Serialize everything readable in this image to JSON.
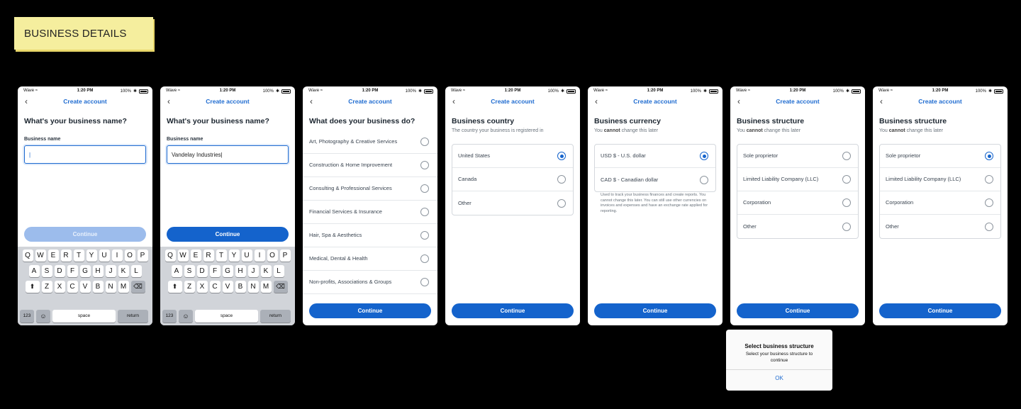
{
  "label": "BUSINESS DETAILS",
  "status_bar": {
    "carrier": "Wave",
    "time": "1:20 PM",
    "battery": "100%"
  },
  "nav_title": "Create account",
  "screens": {
    "name_empty": {
      "heading": "What's your business name?",
      "field_label": "Business name",
      "value": "|",
      "button": "Continue"
    },
    "name_filled": {
      "heading": "What's your business name?",
      "field_label": "Business name",
      "value": "Vandelay Industries|",
      "button": "Continue"
    },
    "industry": {
      "heading": "What does your business do?",
      "options": [
        "Art, Photography & Creative Services",
        "Construction & Home Improvement",
        "Consulting & Professional Services",
        "Financial Services & Insurance",
        "Hair, Spa & Aesthetics",
        "Medical, Dental & Health",
        "Non-profits, Associations & Groups"
      ],
      "button": "Continue"
    },
    "country": {
      "heading": "Business country",
      "sub": "The country your business is registered in",
      "options": [
        "United States",
        "Canada",
        "Other"
      ],
      "selected": "United States",
      "button": "Continue"
    },
    "currency": {
      "heading": "Business currency",
      "sub_pre": "You ",
      "sub_bold": "cannot",
      "sub_post": " change this later",
      "options": [
        "USD $ - U.S. dollar",
        "CAD $ - Canadian dollar"
      ],
      "selected": "USD $ - U.S. dollar",
      "helper": "Used to track your business finances and create reports. You cannot change this later. You can still use other currencies on invoices and expenses and have an exchange rate applied for reporting.",
      "button": "Continue"
    },
    "structure": {
      "heading": "Business structure",
      "sub_pre": "You ",
      "sub_bold": "cannot",
      "sub_post": " change this later",
      "options": [
        "Sole proprietor",
        "Limited Liability Company (LLC)",
        "Corporation",
        "Other"
      ],
      "button": "Continue"
    },
    "structure_selected": {
      "heading": "Business structure",
      "sub_pre": "You ",
      "sub_bold": "cannot",
      "sub_post": " change this later",
      "options": [
        "Sole proprietor",
        "Limited Liability Company (LLC)",
        "Corporation",
        "Other"
      ],
      "selected": "Sole proprietor",
      "button": "Continue"
    }
  },
  "keyboard": {
    "row1": [
      "Q",
      "W",
      "E",
      "R",
      "T",
      "Y",
      "U",
      "I",
      "O",
      "P"
    ],
    "row2": [
      "A",
      "S",
      "D",
      "F",
      "G",
      "H",
      "J",
      "K",
      "L"
    ],
    "row3": [
      "Z",
      "X",
      "C",
      "V",
      "B",
      "N",
      "M"
    ],
    "shift": "⬆",
    "delete": "⌫",
    "numbers": "123",
    "emoji": "☺",
    "space": "space",
    "return": "return"
  },
  "alert": {
    "title": "Select business structure",
    "message": "Select your business structure to continue",
    "ok": "OK"
  },
  "colors": {
    "primary": "#1463cc",
    "link": "#1e6bd0",
    "sticky": "#f5ee9e"
  },
  "icons": {
    "back": "chevron-left-icon",
    "wifi": "wifi-icon",
    "battery": "battery-icon",
    "bluetooth": "bluetooth-icon"
  }
}
